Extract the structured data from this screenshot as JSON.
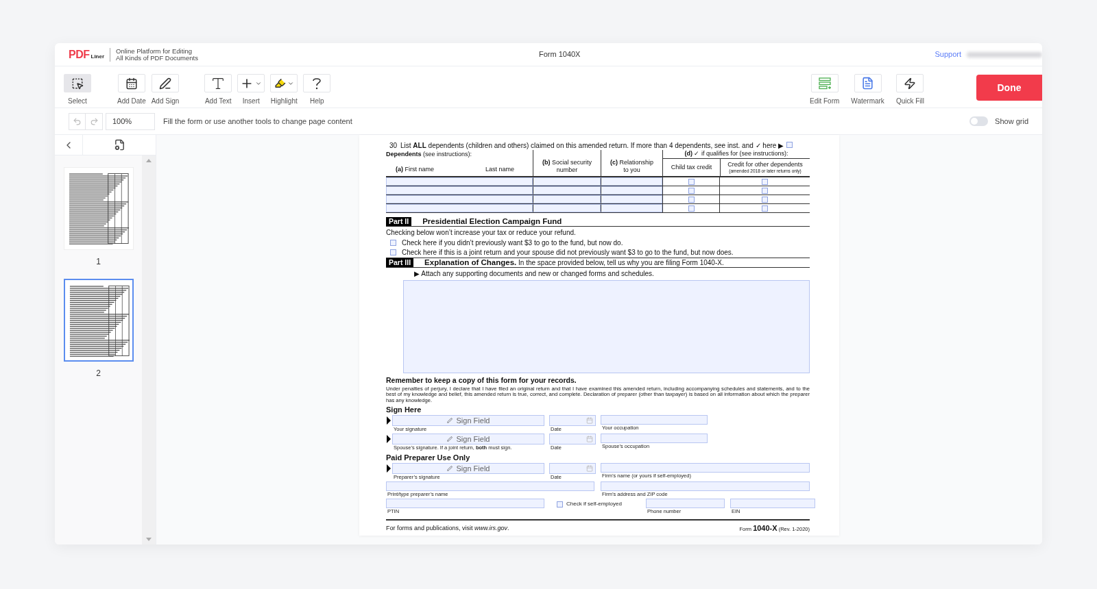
{
  "header": {
    "logo_main": "PDF",
    "logo_sub": "Liner",
    "tagline": [
      "Online Platform for Editing",
      "All Kinds of PDF Documents"
    ],
    "document_title": "Form 1040X",
    "support_link": "Support"
  },
  "toolbar": {
    "tool_groups": [
      [
        {
          "label": "Select",
          "selected": true,
          "dropdown": false
        }
      ],
      [
        {
          "label": "Add Date",
          "selected": false,
          "dropdown": false
        },
        {
          "label": "Add Sign",
          "selected": false,
          "dropdown": false
        }
      ],
      [
        {
          "label": "Add Text",
          "selected": false,
          "dropdown": false
        },
        {
          "label": "Insert",
          "selected": false,
          "dropdown": true
        },
        {
          "label": "Highlight",
          "selected": false,
          "dropdown": true
        },
        {
          "label": "Help",
          "selected": false,
          "dropdown": false
        }
      ]
    ],
    "right_tools": [
      {
        "label": "Edit Form"
      },
      {
        "label": "Watermark"
      },
      {
        "label": "Quick Fill"
      }
    ],
    "done_button": "Done"
  },
  "subbar": {
    "zoom": "100%",
    "hint": "Fill the form or use another tools to change page content",
    "show_grid": {
      "label": "Show grid",
      "on": false
    }
  },
  "pages": [
    {
      "number": "1",
      "selected": false
    },
    {
      "number": "2",
      "selected": true
    }
  ],
  "form": {
    "line_30": {
      "number": "30",
      "text": "List **ALL** dependents (children and others) claimed on this amended return. If more than 4 dependents, see inst. and ✓ here ▶",
      "checked": false
    },
    "dependents": {
      "caption": "**Dependents** (see instructions):",
      "first_name": "**(a)** First name",
      "last_name": "Last name",
      "ssn": "**(b)** Social security number",
      "relationship": "**(c)** Relationship to you",
      "qualifies": "**(d)** ✓ if qualifies for (see instructions):",
      "child_tax_credit": "Child tax credit",
      "other_credit": "Credit for other dependents",
      "other_credit_note": "(amended 2018 or later returns only)",
      "rows": [
        {
          "child_tax_credit": false,
          "other_credit": false
        },
        {
          "child_tax_credit": false,
          "other_credit": false
        },
        {
          "child_tax_credit": false,
          "other_credit": false
        },
        {
          "child_tax_credit": false,
          "other_credit": false
        }
      ]
    },
    "part_2": {
      "tag": "Part II",
      "title": "Presidential Election Campaign Fund",
      "note": "Checking below won’t increase your tax or reduce your refund.",
      "checks": [
        {
          "label": "Check here if you didn’t previously want $3 to go to the fund, but now do.",
          "checked": false
        },
        {
          "label": "Check here if this is a joint return and your spouse did not previously want $3 to go to the fund, but now does.",
          "checked": false
        }
      ]
    },
    "part_3": {
      "tag": "Part III",
      "title": "**Explanation of Changes.** In the space provided below, tell us why you are filing Form 1040-X.",
      "attach": "▶ Attach any supporting documents and new or changed forms and schedules."
    },
    "reminder": "Remember to keep a copy of this form for your records.",
    "perjury": "Under penalties of perjury, I declare that I have filed an original return and that I have examined this amended return, including accompanying schedules and statements, and to the best of my knowledge and belief, this amended return is true, correct, and complete. Declaration of preparer (other than taxpayer) is based on all information about which the preparer has any knowledge.",
    "sections": [
      {
        "heading": "Sign Here",
        "rows": [
          [
            {
              "kind": "sign",
              "placeholder": "Sign Field",
              "label": "Your signature"
            },
            {
              "kind": "date",
              "label": "Date"
            },
            {
              "kind": "text",
              "label": "Your occupation"
            }
          ],
          [
            {
              "kind": "sign",
              "placeholder": "Sign Field",
              "label": "Spouse’s signature. If a joint return, **both** must sign."
            },
            {
              "kind": "date",
              "label": "Date"
            },
            {
              "kind": "text",
              "label": "Spouse’s occupation"
            }
          ]
        ]
      },
      {
        "heading": "Paid Preparer Use Only",
        "rows": [
          [
            {
              "kind": "sign",
              "placeholder": "Sign Field",
              "label": "Preparer’s signature"
            },
            {
              "kind": "date",
              "label": "Date"
            },
            {
              "kind": "text",
              "label": "Firm’s name (or yours if self-employed)"
            }
          ],
          [
            {
              "kind": "text",
              "label": "Print/type preparer’s name"
            },
            {
              "kind": "text",
              "label": "Firm’s address and ZIP code"
            }
          ],
          [
            {
              "kind": "text",
              "label": "PTIN"
            },
            {
              "kind": "checkbox",
              "label": "Check if self-employed",
              "checked": false
            },
            {
              "kind": "text",
              "label": "Phone number"
            },
            {
              "kind": "text",
              "label": "EIN"
            }
          ]
        ]
      }
    ],
    "footer_left": "For forms and publications, visit *www.irs.gov*.",
    "footer_right": "Form **1040-X** (Rev. 1-2020)"
  }
}
